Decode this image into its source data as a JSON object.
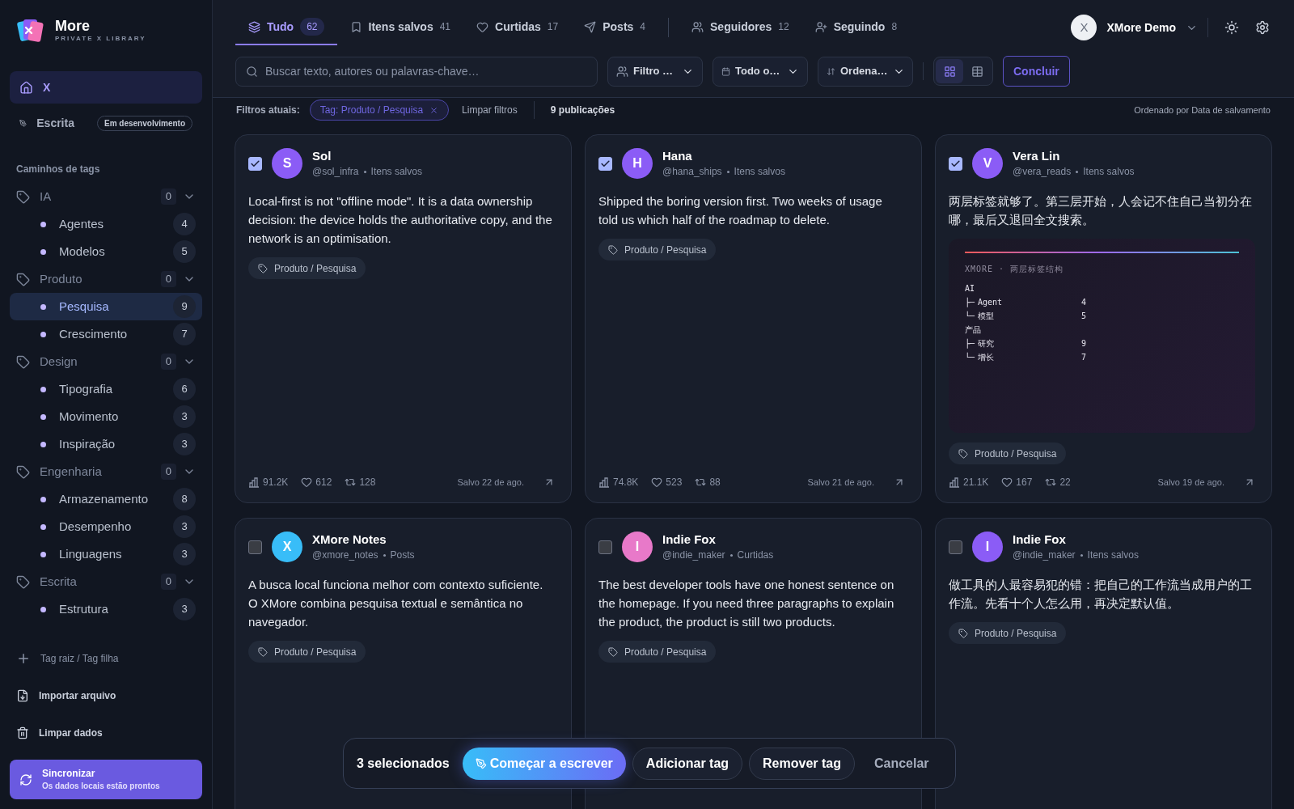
{
  "brand": {
    "name": "More",
    "tagline": "PRIVATE X LIBRARY"
  },
  "nav": [
    {
      "kind": "home",
      "label": "X",
      "selected": true
    },
    {
      "kind": "write",
      "label": "Escrita",
      "badge": "Em desenvolvimento",
      "selected": false
    }
  ],
  "tag_section": {
    "title": "Caminhos de tags",
    "groups": [
      {
        "name": "IA",
        "count": "0",
        "expanded": true,
        "children": [
          {
            "name": "Agentes",
            "count": "4",
            "selected": false
          },
          {
            "name": "Modelos",
            "count": "5",
            "selected": false
          }
        ]
      },
      {
        "name": "Produto",
        "count": "0",
        "expanded": true,
        "children": [
          {
            "name": "Pesquisa",
            "count": "9",
            "selected": true
          },
          {
            "name": "Crescimento",
            "count": "7",
            "selected": false
          }
        ]
      },
      {
        "name": "Design",
        "count": "0",
        "expanded": true,
        "children": [
          {
            "name": "Tipografia",
            "count": "6",
            "selected": false
          },
          {
            "name": "Movimento",
            "count": "3",
            "selected": false
          },
          {
            "name": "Inspiração",
            "count": "3",
            "selected": false
          }
        ]
      },
      {
        "name": "Engenharia",
        "count": "0",
        "expanded": true,
        "children": [
          {
            "name": "Armazenamento",
            "count": "8",
            "selected": false
          },
          {
            "name": "Desempenho",
            "count": "3",
            "selected": false
          },
          {
            "name": "Linguagens",
            "count": "3",
            "selected": false
          }
        ]
      },
      {
        "name": "Escrita",
        "count": "0",
        "expanded": true,
        "children": [
          {
            "name": "Estrutura",
            "count": "3",
            "selected": false
          }
        ]
      }
    ]
  },
  "sidebar_actions": [
    {
      "kind": "add",
      "label": "Tag raiz / Tag filha"
    },
    {
      "kind": "import",
      "label": "Importar arquivo"
    },
    {
      "kind": "clear",
      "label": "Limpar dados"
    }
  ],
  "sync": {
    "title": "Sincronizar",
    "subtitle": "Os dados locais estão prontos"
  },
  "tabs": [
    {
      "label": "Tudo",
      "count": "62",
      "selected": true
    },
    {
      "label": "Itens salvos",
      "count": "41",
      "selected": false
    },
    {
      "label": "Curtidas",
      "count": "17",
      "selected": false
    },
    {
      "label": "Posts",
      "count": "4",
      "selected": false
    },
    {
      "label": "Seguidores",
      "count": "12",
      "selected": false
    },
    {
      "label": "Seguindo",
      "count": "8",
      "selected": false
    }
  ],
  "user": {
    "initial": "X",
    "name": "XMore Demo"
  },
  "search": {
    "placeholder": "Buscar texto, autores ou palavras-chave…"
  },
  "filters": [
    {
      "label": "Filtro …"
    },
    {
      "label": "Todo o…"
    },
    {
      "label": "Ordena…"
    }
  ],
  "view_modes": [
    {
      "kind": "grid",
      "selected": true
    },
    {
      "kind": "list",
      "selected": false
    }
  ],
  "done_button": "Concluir",
  "filter_bar": {
    "label": "Filtros atuais:",
    "chips": [
      {
        "label": "Tag: Produto / Pesquisa"
      }
    ],
    "clear": "Limpar filtros",
    "count": "9 publicações",
    "sort_note": "Ordenado por Data de salvamento"
  },
  "posts": [
    {
      "checked": true,
      "initial": "S",
      "color": "#8b5cf6",
      "name": "Sol",
      "handle": "@sol_infra",
      "source": "Itens salvos",
      "text": "Local-first is not \"offline mode\". It is a data ownership decision: the device holds the authoritative copy, and the network is an optimisation.",
      "tag": "Produto / Pesquisa",
      "views": "91.2K",
      "likes": "612",
      "reposts": "128",
      "saved": "Salvo 22 de ago."
    },
    {
      "checked": true,
      "initial": "H",
      "color": "#8b5cf6",
      "name": "Hana",
      "handle": "@hana_ships",
      "source": "Itens salvos",
      "text": "Shipped the boring version first. Two weeks of usage told us which half of the roadmap to delete.",
      "tag": "Produto / Pesquisa",
      "views": "74.8K",
      "likes": "523",
      "reposts": "88",
      "saved": "Salvo 21 de ago."
    },
    {
      "checked": true,
      "initial": "V",
      "color": "#8b5cf6",
      "name": "Vera Lin",
      "handle": "@vera_reads",
      "source": "Itens salvos",
      "text": "两层标签就够了。第三层开始，人会记不住自己当初分在哪，最后又退回全文搜索。",
      "image": {
        "caption": "XMORE · 两层标签结构",
        "tree": [
          {
            "label": "AI",
            "children": [
              {
                "prefix": "├─",
                "label": "Agent",
                "count": "4"
              },
              {
                "prefix": "└─",
                "label": "模型",
                "count": "5"
              }
            ]
          },
          {
            "label": "产品",
            "children": [
              {
                "prefix": "├─",
                "label": "研究",
                "count": "9"
              },
              {
                "prefix": "└─",
                "label": "增长",
                "count": "7"
              }
            ]
          }
        ]
      },
      "tag": "Produto / Pesquisa",
      "views": "21.1K",
      "likes": "167",
      "reposts": "22",
      "saved": "Salvo 19 de ago."
    },
    {
      "checked": false,
      "initial": "X",
      "color": "#38bdf8",
      "name": "XMore Notes",
      "handle": "@xmore_notes",
      "source": "Posts",
      "text": "A busca local funciona melhor com contexto suficiente. O XMore combina pesquisa textual e semântica no navegador.",
      "tag": "Produto / Pesquisa"
    },
    {
      "checked": false,
      "initial": "I",
      "color": "#e879c9",
      "name": "Indie Fox",
      "handle": "@indie_maker",
      "source": "Curtidas",
      "text": "The best developer tools have one honest sentence on the homepage. If you need three paragraphs to explain the product, the product is still two products.",
      "tag": "Produto / Pesquisa"
    },
    {
      "checked": false,
      "initial": "I",
      "color": "#8b5cf6",
      "name": "Indie Fox",
      "handle": "@indie_maker",
      "source": "Itens salvos",
      "text": "做工具的人最容易犯的错：把自己的工作流当成用户的工作流。先看十个人怎么用，再决定默认值。",
      "tag": "Produto / Pesquisa"
    }
  ],
  "selection_bar": {
    "count": "3 selecionados",
    "actions": [
      {
        "kind": "primary",
        "label": "Começar a escrever"
      },
      {
        "kind": "secondary",
        "label": "Adicionar tag"
      },
      {
        "kind": "secondary",
        "label": "Remover tag"
      },
      {
        "kind": "ghost",
        "label": "Cancelar"
      }
    ]
  }
}
